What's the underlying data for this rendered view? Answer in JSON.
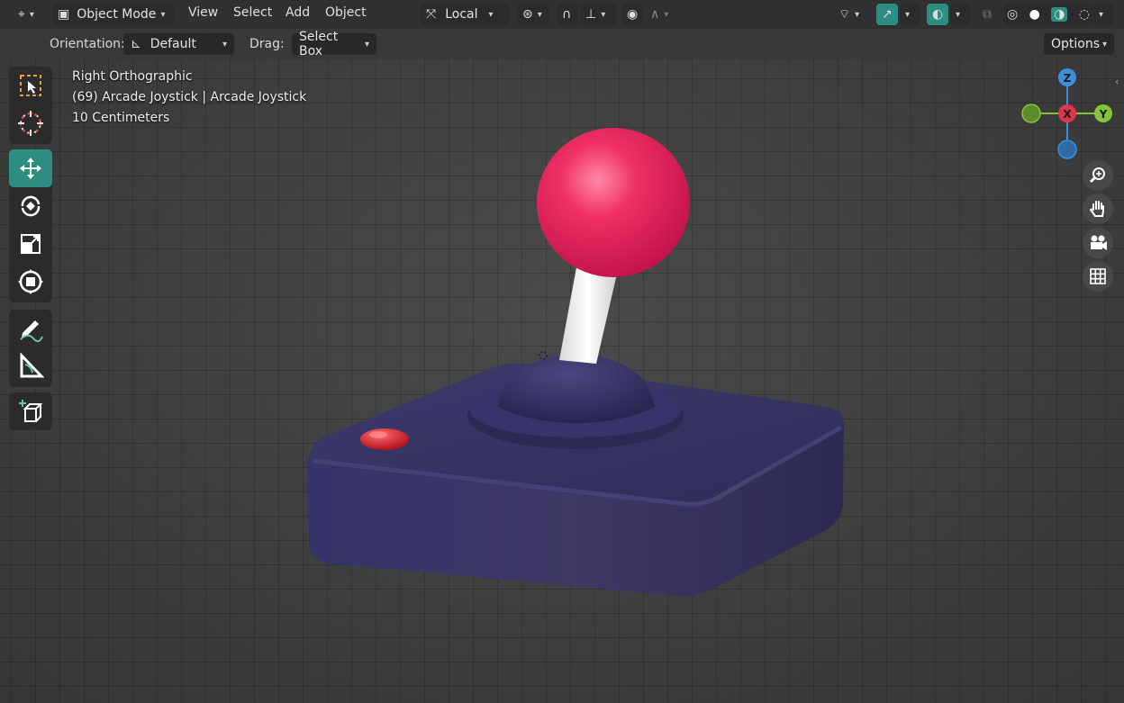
{
  "header": {
    "mode_label": "Object Mode",
    "menus": [
      "View",
      "Select",
      "Add",
      "Object"
    ],
    "pivot_label": "Local",
    "options_label": "Options"
  },
  "tool_settings": {
    "orientation_label": "Orientation:",
    "orientation_value": "Default",
    "drag_label": "Drag:",
    "drag_value": "Select Box"
  },
  "viewport_info": {
    "view_name": "Right Orthographic",
    "object_info": "(69) Arcade Joystick | Arcade Joystick",
    "scale": "10 Centimeters"
  },
  "gizmo": {
    "axis_z": "Z",
    "axis_x": "X",
    "axis_y": "Y"
  },
  "left_tools": [
    {
      "icon": "select-box-icon",
      "active": false
    },
    {
      "icon": "cursor-icon",
      "active": false
    },
    {
      "icon": "move-icon",
      "active": true
    },
    {
      "icon": "rotate-icon",
      "active": false
    },
    {
      "icon": "scale-icon",
      "active": false
    },
    {
      "icon": "transform-icon",
      "active": false
    },
    {
      "icon": "annotate-icon",
      "active": false
    },
    {
      "icon": "measure-icon",
      "active": false
    },
    {
      "icon": "add-cube-icon",
      "active": false
    }
  ],
  "colors": {
    "accent": "#2c8d80",
    "joystick_ball": "#e8205a",
    "joystick_base": "#35335f",
    "axis_x": "#e0344a",
    "axis_y": "#86c23a",
    "axis_z": "#3a8fdc"
  }
}
